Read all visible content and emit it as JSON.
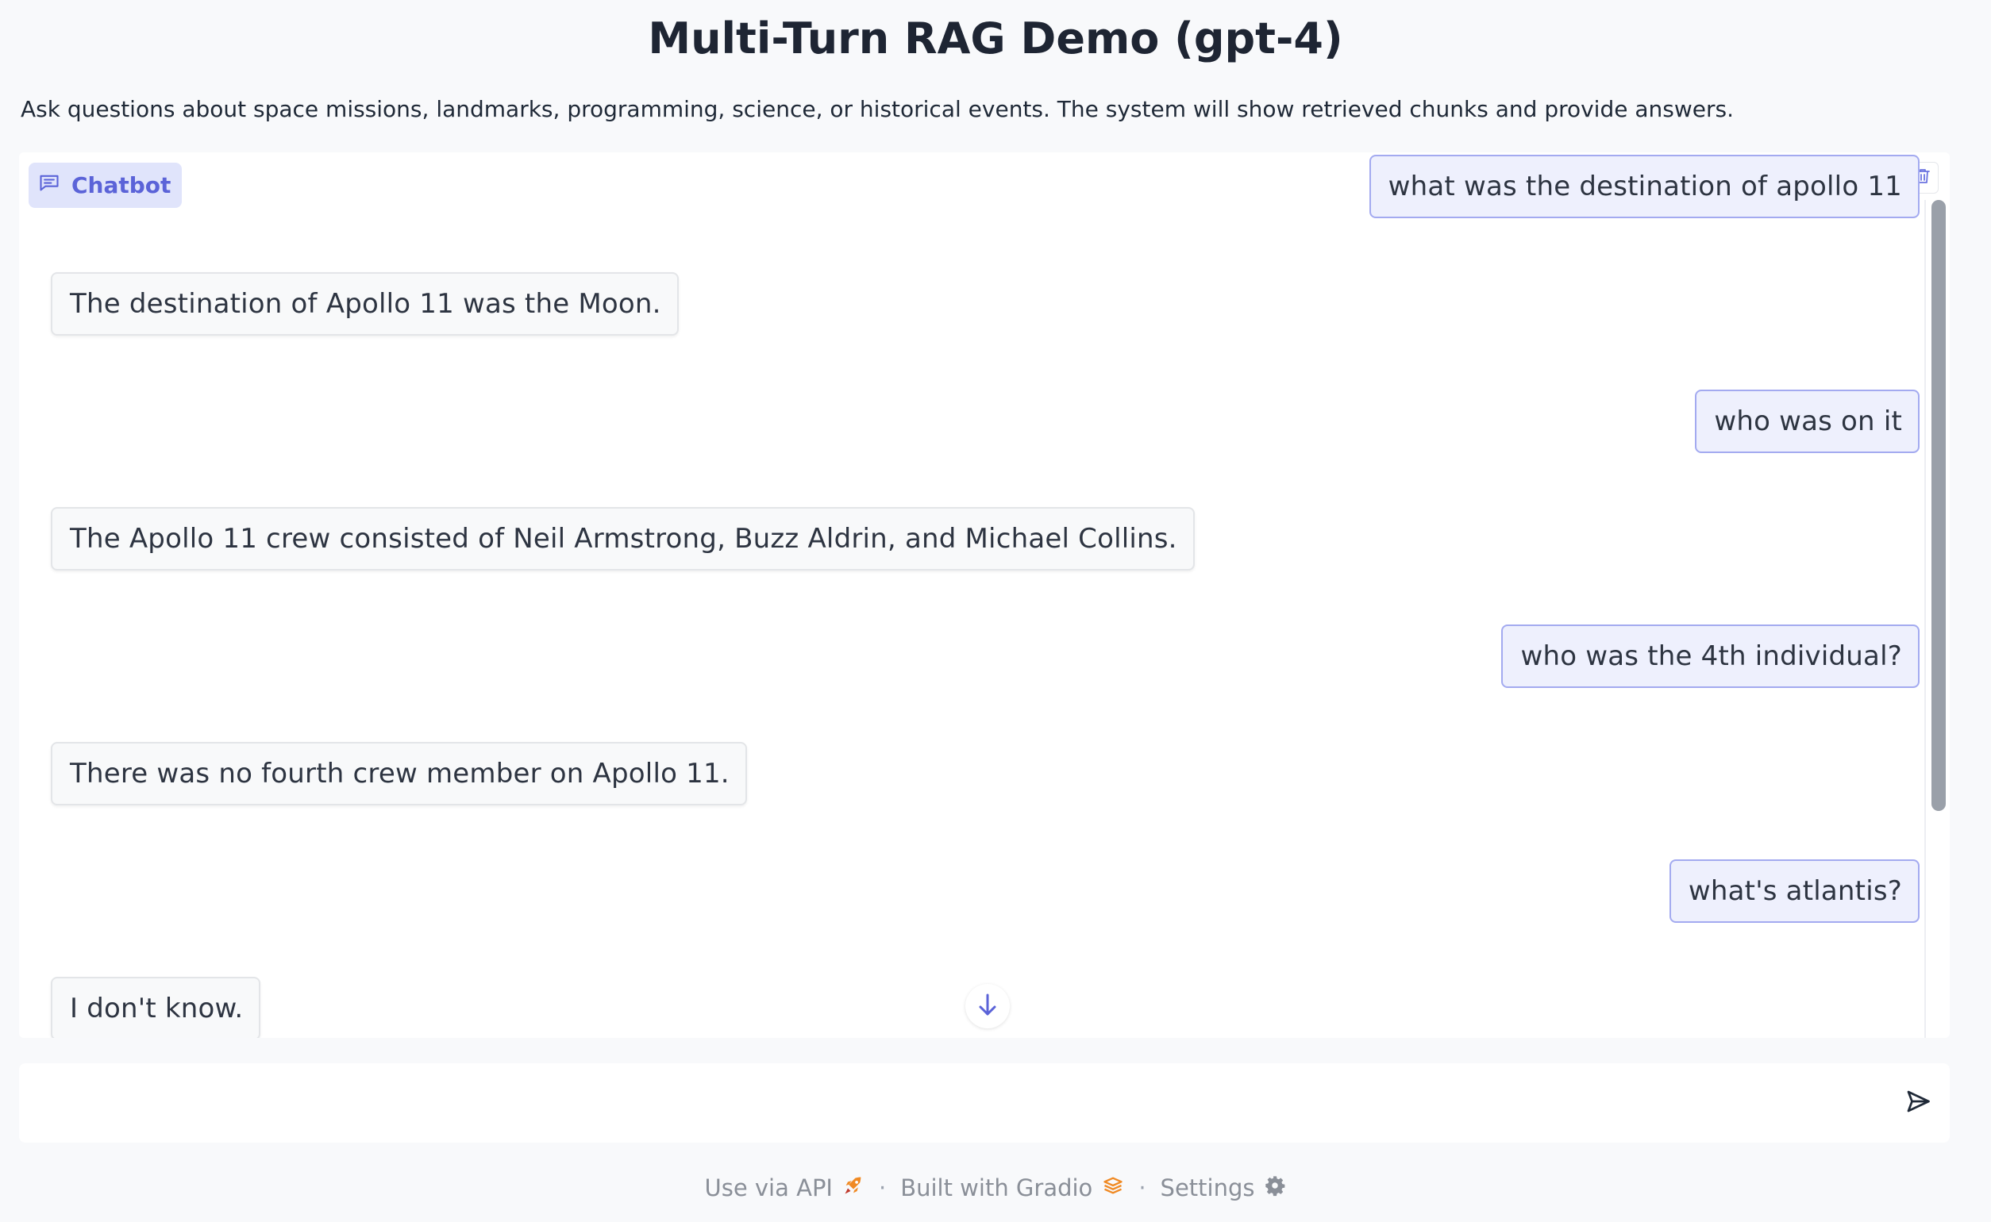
{
  "header": {
    "title": "Multi-Turn RAG Demo (gpt-4)",
    "description": "Ask questions about space missions, landmarks, programming, science, or historical events. The system will show retrieved chunks and provide answers."
  },
  "chatbot": {
    "label": "Chatbot",
    "messages": [
      {
        "role": "user",
        "text": "what was the destination of apollo 11"
      },
      {
        "role": "assistant",
        "text": "The destination of Apollo 11 was the Moon."
      },
      {
        "role": "user",
        "text": "who was on it"
      },
      {
        "role": "assistant",
        "text": "The Apollo 11 crew consisted of Neil Armstrong, Buzz Aldrin, and Michael Collins."
      },
      {
        "role": "user",
        "text": "who was the 4th individual?"
      },
      {
        "role": "assistant",
        "text": "There was no fourth crew member on Apollo 11."
      },
      {
        "role": "user",
        "text": "what's atlantis?"
      },
      {
        "role": "assistant",
        "text": "I don't know."
      }
    ],
    "icons": {
      "label": "chat-icon",
      "clear": "trash-icon",
      "scroll_down": "arrow-down-icon"
    }
  },
  "input": {
    "value": "",
    "placeholder": "",
    "send_icon": "send-icon"
  },
  "footer": {
    "api_label": "Use via API",
    "built_label": "Built with Gradio",
    "settings_label": "Settings",
    "separator": "·"
  },
  "colors": {
    "accent": "#5b63d8",
    "user_bubble_bg": "#eef0fd",
    "user_bubble_border": "#a3aaf0",
    "bot_bubble_bg": "#f8f9fa"
  }
}
